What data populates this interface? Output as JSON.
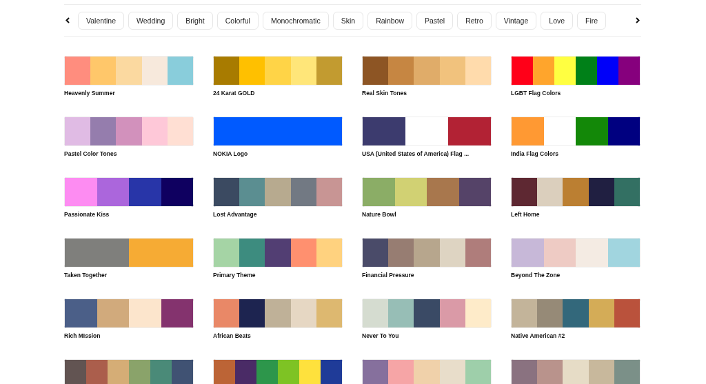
{
  "categories": [
    {
      "label": "Valentine"
    },
    {
      "label": "Wedding"
    },
    {
      "label": "Bright"
    },
    {
      "label": "Colorful"
    },
    {
      "label": "Monochromatic"
    },
    {
      "label": "Skin"
    },
    {
      "label": "Rainbow"
    },
    {
      "label": "Pastel"
    },
    {
      "label": "Retro"
    },
    {
      "label": "Vintage"
    },
    {
      "label": "Love"
    },
    {
      "label": "Fire"
    }
  ],
  "palettes": [
    {
      "name": "Heavenly Summer",
      "swatches": [
        {
          "color": "#ff8d7e"
        },
        {
          "color": "#ffc76a"
        },
        {
          "color": "#fbd9a0"
        },
        {
          "color": "#f7e9dc"
        },
        {
          "color": "#89cddb"
        }
      ]
    },
    {
      "name": "24 Karat GOLD",
      "swatches": [
        {
          "color": "#a87b00"
        },
        {
          "color": "#ffc000"
        },
        {
          "color": "#ffd447"
        },
        {
          "color": "#ffe679"
        },
        {
          "color": "#c29b30"
        }
      ]
    },
    {
      "name": "Real Skin Tones",
      "swatches": [
        {
          "color": "#8d5524"
        },
        {
          "color": "#c68642"
        },
        {
          "color": "#e0ac69"
        },
        {
          "color": "#f1c27d"
        },
        {
          "color": "#ffdbac"
        }
      ]
    },
    {
      "name": "LGBT Flag Colors",
      "swatches": [
        {
          "color": "#ff0018"
        },
        {
          "color": "#ffa52c"
        },
        {
          "color": "#ffff41"
        },
        {
          "color": "#008018"
        },
        {
          "color": "#0000f9"
        },
        {
          "color": "#86007d"
        }
      ]
    },
    {
      "name": "Pastel Color Tones",
      "swatches": [
        {
          "color": "#e0bbe4"
        },
        {
          "color": "#957dad"
        },
        {
          "color": "#d291bc"
        },
        {
          "color": "#fec8d8"
        },
        {
          "color": "#ffdfd3"
        }
      ]
    },
    {
      "name": "NOKIA Logo",
      "swatches": [
        {
          "color": "#005aff"
        }
      ]
    },
    {
      "name": "USA (United States of America) Flag ...",
      "swatches": [
        {
          "color": "#3c3b6e"
        },
        {
          "color": "#ffffff"
        },
        {
          "color": "#b22234"
        }
      ]
    },
    {
      "name": "India Flag Colors",
      "swatches": [
        {
          "color": "#ff9933"
        },
        {
          "color": "#ffffff"
        },
        {
          "color": "#138808"
        },
        {
          "color": "#000080"
        }
      ]
    },
    {
      "name": "Passionate Kiss",
      "swatches": [
        {
          "color": "#fd8cf2"
        },
        {
          "color": "#ab66dc"
        },
        {
          "color": "#2835a8"
        },
        {
          "color": "#0f0060"
        }
      ]
    },
    {
      "name": "Lost Advantage",
      "swatches": [
        {
          "color": "#3b4a61"
        },
        {
          "color": "#5b8e91"
        },
        {
          "color": "#b7aa8f"
        },
        {
          "color": "#727983"
        },
        {
          "color": "#c89594"
        }
      ]
    },
    {
      "name": "Nature Bowl",
      "swatches": [
        {
          "color": "#8bad66"
        },
        {
          "color": "#d1d173"
        },
        {
          "color": "#a8774d"
        },
        {
          "color": "#554368"
        }
      ]
    },
    {
      "name": "Left Home",
      "swatches": [
        {
          "color": "#5e2832"
        },
        {
          "color": "#dbcfbd"
        },
        {
          "color": "#bb7f32"
        },
        {
          "color": "#201f41"
        },
        {
          "color": "#337063"
        }
      ]
    },
    {
      "name": "Taken Together",
      "swatches": [
        {
          "color": "#7f7f7c"
        },
        {
          "color": "#f6ab34"
        }
      ]
    },
    {
      "name": "Primary Theme",
      "swatches": [
        {
          "color": "#a5d4a5"
        },
        {
          "color": "#3d8c7f"
        },
        {
          "color": "#523e73"
        },
        {
          "color": "#ff906f"
        },
        {
          "color": "#ffd27f"
        }
      ]
    },
    {
      "name": "Financial Pressure",
      "swatches": [
        {
          "color": "#4a4b69"
        },
        {
          "color": "#977d72"
        },
        {
          "color": "#b7a68d"
        },
        {
          "color": "#ded4c2"
        },
        {
          "color": "#af7d7b"
        }
      ]
    },
    {
      "name": "Beyond The Zone",
      "swatches": [
        {
          "color": "#c7b8d8"
        },
        {
          "color": "#eecbc4"
        },
        {
          "color": "#f4ebe3"
        },
        {
          "color": "#a1d5df"
        }
      ]
    },
    {
      "name": "Rich MIssion",
      "swatches": [
        {
          "color": "#4b5f88"
        },
        {
          "color": "#d1aa7c"
        },
        {
          "color": "#fce5cc"
        },
        {
          "color": "#84336e"
        }
      ]
    },
    {
      "name": "African Beats",
      "swatches": [
        {
          "color": "#e98867"
        },
        {
          "color": "#1d2450"
        },
        {
          "color": "#bfb198"
        },
        {
          "color": "#e6d7c3"
        },
        {
          "color": "#ddb870"
        }
      ]
    },
    {
      "name": "Never To You",
      "swatches": [
        {
          "color": "#d5dcd0"
        },
        {
          "color": "#97beb6"
        },
        {
          "color": "#3a4a65"
        },
        {
          "color": "#da9aa7"
        },
        {
          "color": "#feebc9"
        }
      ]
    },
    {
      "name": "Native American #2",
      "swatches": [
        {
          "color": "#c3b49a"
        },
        {
          "color": "#968a77"
        },
        {
          "color": "#33687b"
        },
        {
          "color": "#d4ac57"
        },
        {
          "color": "#ba523c"
        }
      ]
    },
    {
      "swatches": [
        {
          "color": "#625452"
        },
        {
          "color": "#ab5e4c"
        },
        {
          "color": "#d5ad76"
        },
        {
          "color": "#8aa36a"
        },
        {
          "color": "#4a8a78"
        },
        {
          "color": "#405273"
        }
      ]
    },
    {
      "swatches": [
        {
          "color": "#bc6436"
        },
        {
          "color": "#4a2b66"
        },
        {
          "color": "#2d964b"
        },
        {
          "color": "#7ec324"
        },
        {
          "color": "#fee13d"
        },
        {
          "color": "#1f3b98"
        }
      ]
    },
    {
      "swatches": [
        {
          "color": "#86709d"
        },
        {
          "color": "#f6a5a6"
        },
        {
          "color": "#f0d1aa"
        },
        {
          "color": "#e8ddca"
        },
        {
          "color": "#9ecfaa"
        }
      ]
    },
    {
      "swatches": [
        {
          "color": "#8a7280"
        },
        {
          "color": "#b9938c"
        },
        {
          "color": "#e6dcc6"
        },
        {
          "color": "#c8b89c"
        },
        {
          "color": "#7b9088"
        }
      ]
    }
  ]
}
